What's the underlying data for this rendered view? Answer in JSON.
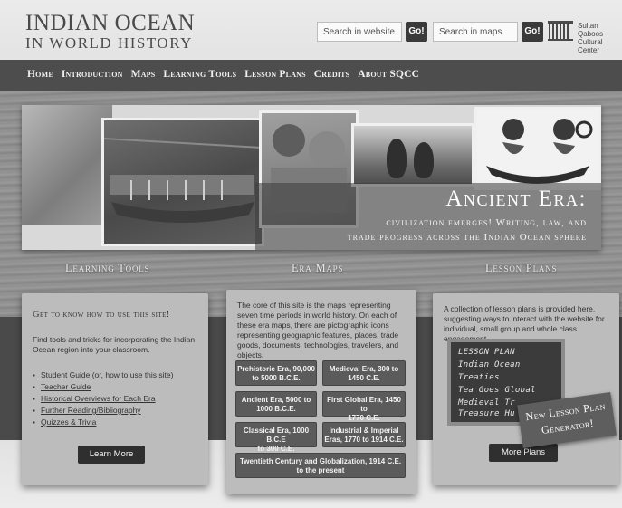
{
  "header": {
    "logo_line1": "INDIAN OCEAN",
    "logo_line2": "IN WORLD HISTORY",
    "search_website": {
      "placeholder": "Search in website",
      "go_label": "Go!"
    },
    "search_maps": {
      "placeholder": "Search in maps",
      "go_label": "Go!"
    },
    "partner_logo_icon": "building-columns-icon",
    "partner_line1": "Sultan Qaboos",
    "partner_line2": "Cultural Center"
  },
  "nav": {
    "items": [
      "Home",
      "Introduction",
      "Maps",
      "Learning Tools",
      "Lesson Plans",
      "Credits",
      "About SQCC"
    ]
  },
  "banner": {
    "title": "Ancient Era:",
    "subtitle_line1": "civilization emerges! Writing, law, and",
    "subtitle_line2": "trade progress across the Indian Ocean sphere"
  },
  "sections": {
    "learning_tools": "Learning Tools",
    "era_maps": "Era Maps",
    "lesson_plans": "Lesson Plans"
  },
  "learning_card": {
    "heading": "Get to know how to use this site!",
    "description": "Find tools and tricks for incorporating the Indian Ocean region into your classroom.",
    "links": [
      "Student Guide (or, how to use this site)",
      "Teacher Guide",
      "Historical Overviews for Each Era",
      "Further Reading/Bibliography",
      "Quizzes & Trivia"
    ],
    "button": "Learn More"
  },
  "maps_card": {
    "description": "The core of this site is the maps representing seven time periods in world history. On each of these era maps, there are pictographic icons representing geographic features, places, trade goods, documents, technologies, travelers, and objects.",
    "eras": [
      {
        "line1": "Prehistoric Era, 90,000",
        "line2": "to 5000 B.C.E."
      },
      {
        "line1": "Medieval Era, 300 to",
        "line2": "1450 C.E."
      },
      {
        "line1": "Ancient Era, 5000 to",
        "line2": "1000 B.C.E."
      },
      {
        "line1": "First Global Era, 1450 to",
        "line2": "1770 C.E."
      },
      {
        "line1": "Classical Era, 1000 B.C.E",
        "line2": "to 300 C.E."
      },
      {
        "line1": "Industrial & Imperial",
        "line2": "Eras, 1770 to 1914 C.E."
      },
      {
        "line1": "Twentieth Century and Globalization, 1914 C.E.",
        "line2": "to the present"
      }
    ]
  },
  "lessons_card": {
    "description": "A collection of lesson plans is provided here, suggesting ways to interact with the website for individual, small group and whole class engagement.",
    "chalkboard": [
      "LESSON PLAN",
      "Indian Ocean",
      "Treaties",
      "Tea Goes Global",
      "Medieval Tr",
      "Treasure Hu"
    ],
    "generator_line1": "New Lesson Plan",
    "generator_line2": "Generator!",
    "button": "More Plans"
  }
}
